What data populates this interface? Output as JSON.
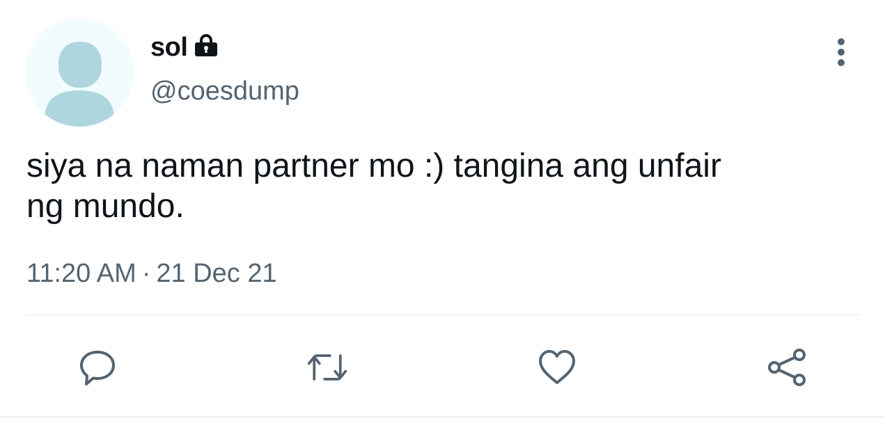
{
  "tweet": {
    "author": {
      "display_name": "sol",
      "handle": "@coesdump",
      "protected_icon": "lock-icon",
      "avatar_icon": "default-avatar-icon"
    },
    "text_line1": "siya na naman partner mo :) tangina ang unfair",
    "text_line2": "ng mundo.",
    "time": "11:20 AM",
    "separator": "·",
    "date": "21 Dec 21"
  },
  "actions": [
    {
      "icon": "reply-icon"
    },
    {
      "icon": "retweet-icon"
    },
    {
      "icon": "like-icon"
    },
    {
      "icon": "share-icon"
    }
  ],
  "menu": {
    "icon": "more-options-icon"
  },
  "colors": {
    "primary_text": "#0f1419",
    "secondary_text": "#536471",
    "avatar_bg": "#f2fbfd",
    "avatar_fg": "#aed6df",
    "divider": "#eff3f4"
  }
}
